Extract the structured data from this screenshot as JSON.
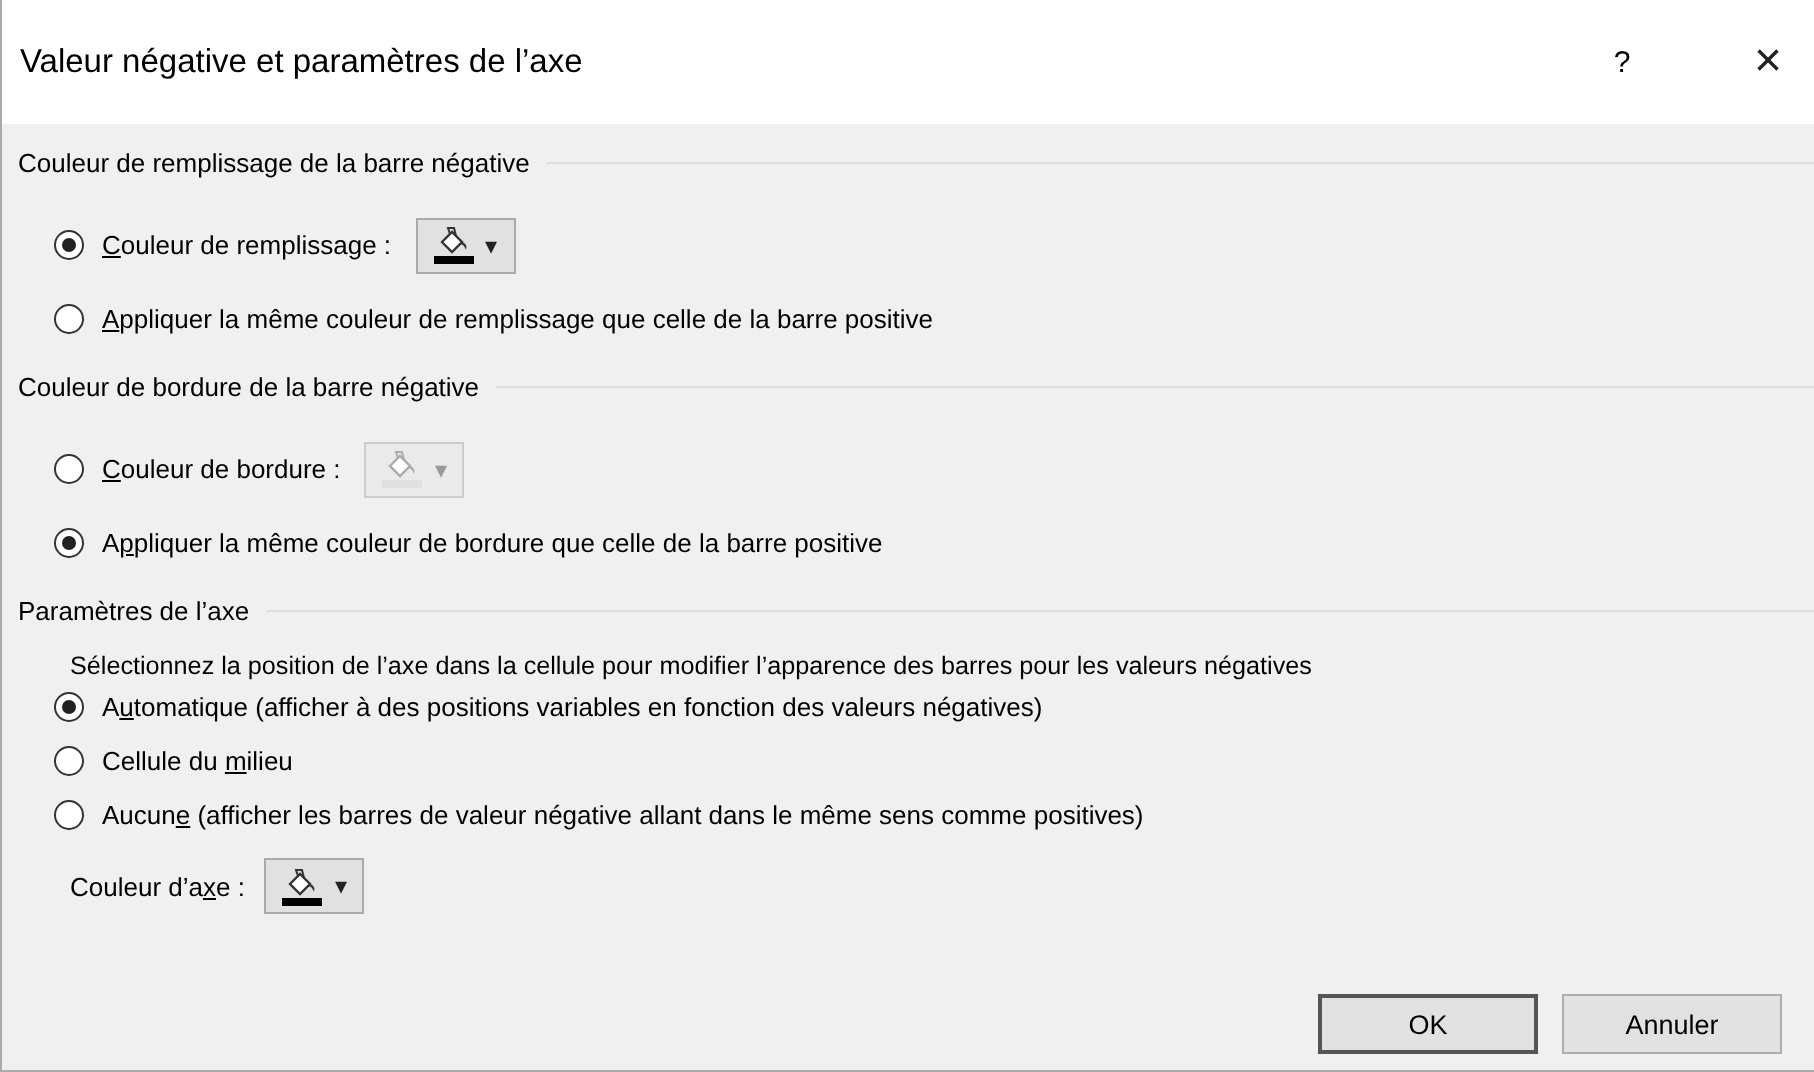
{
  "window": {
    "title": "Valeur négative et paramètres de l’axe",
    "help": "?",
    "close": "×"
  },
  "sections": [
    {
      "heading": "Couleur de remplissage de la barre négative",
      "items": [
        {
          "kind": "radio",
          "selected": true,
          "label": [
            {
              "text": "C",
              "underline": true
            },
            {
              "text": "ouleur de remplissage :",
              "underline": false
            }
          ],
          "color_button": {
            "disabled": false,
            "color": "#000000",
            "caret": "▾"
          }
        },
        {
          "kind": "radio",
          "selected": false,
          "label": [
            {
              "text": "A",
              "underline": true
            },
            {
              "text": "ppliquer la même couleur de remplissage que celle de la barre positive",
              "underline": false
            }
          ]
        }
      ]
    },
    {
      "heading": "Couleur de bordure de la barre négative",
      "items": [
        {
          "kind": "radio",
          "selected": false,
          "label": [
            {
              "text": "C",
              "underline": true
            },
            {
              "text": "ouleur de bordure :",
              "underline": false
            }
          ],
          "color_button": {
            "disabled": true,
            "color": "#e0e0e0",
            "caret": "▾"
          }
        },
        {
          "kind": "radio",
          "selected": true,
          "label": [
            {
              "text": "A",
              "underline": false
            },
            {
              "text": "p",
              "underline": true
            },
            {
              "text": "pliquer la même couleur de bordure que celle de la barre positive",
              "underline": false
            }
          ]
        }
      ]
    },
    {
      "heading": "Paramètres de l’axe",
      "items": [
        {
          "kind": "text",
          "label": [
            {
              "text": "Sélectionnez la position de l’axe dans la cellule pour modifier l’apparence des barres pour les valeurs négatives",
              "underline": false
            }
          ]
        },
        {
          "kind": "radio",
          "selected": true,
          "label": [
            {
              "text": "A",
              "underline": false
            },
            {
              "text": "u",
              "underline": true
            },
            {
              "text": "tomatique (afficher à des positions variables en fonction des valeurs négatives)",
              "underline": false
            }
          ]
        },
        {
          "kind": "radio",
          "selected": false,
          "label": [
            {
              "text": "Cellule du ",
              "underline": false
            },
            {
              "text": "m",
              "underline": true
            },
            {
              "text": "ilieu",
              "underline": false
            }
          ]
        },
        {
          "kind": "radio",
          "selected": false,
          "label": [
            {
              "text": "Aucun",
              "underline": false
            },
            {
              "text": "e",
              "underline": true
            },
            {
              "text": " (afficher les barres de valeur négative allant dans le même sens comme positives)",
              "underline": false
            }
          ]
        },
        {
          "kind": "color",
          "label": [
            {
              "text": "Couleur d’a",
              "underline": false
            },
            {
              "text": "x",
              "underline": true
            },
            {
              "text": "e :",
              "underline": false
            }
          ],
          "color_button": {
            "disabled": false,
            "color": "#000000",
            "caret": "▾"
          }
        }
      ]
    }
  ],
  "buttons": [
    {
      "label": "OK",
      "default": true
    },
    {
      "label": "Annuler",
      "default": false
    }
  ]
}
